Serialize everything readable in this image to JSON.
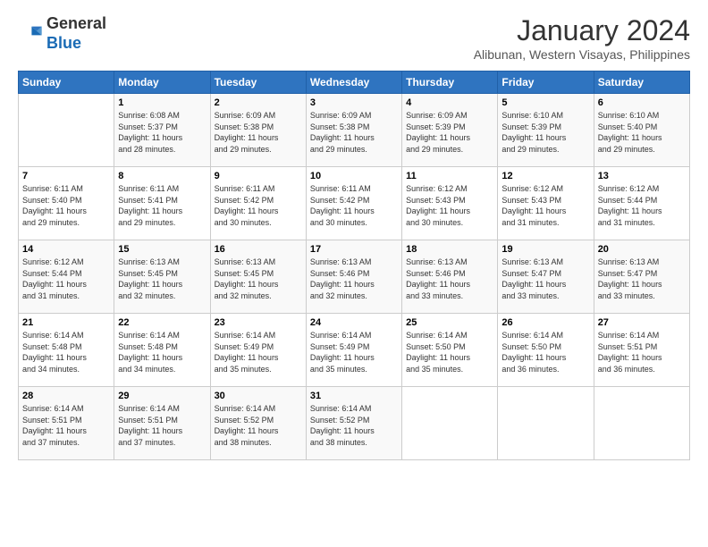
{
  "logo": {
    "general": "General",
    "blue": "Blue"
  },
  "title": "January 2024",
  "subtitle": "Alibunan, Western Visayas, Philippines",
  "days_of_week": [
    "Sunday",
    "Monday",
    "Tuesday",
    "Wednesday",
    "Thursday",
    "Friday",
    "Saturday"
  ],
  "weeks": [
    [
      {
        "day": "",
        "sunrise": "",
        "sunset": "",
        "daylight": ""
      },
      {
        "day": "1",
        "sunrise": "6:08 AM",
        "sunset": "5:37 PM",
        "daylight": "11 hours and 28 minutes."
      },
      {
        "day": "2",
        "sunrise": "6:09 AM",
        "sunset": "5:38 PM",
        "daylight": "11 hours and 29 minutes."
      },
      {
        "day": "3",
        "sunrise": "6:09 AM",
        "sunset": "5:38 PM",
        "daylight": "11 hours and 29 minutes."
      },
      {
        "day": "4",
        "sunrise": "6:09 AM",
        "sunset": "5:39 PM",
        "daylight": "11 hours and 29 minutes."
      },
      {
        "day": "5",
        "sunrise": "6:10 AM",
        "sunset": "5:39 PM",
        "daylight": "11 hours and 29 minutes."
      },
      {
        "day": "6",
        "sunrise": "6:10 AM",
        "sunset": "5:40 PM",
        "daylight": "11 hours and 29 minutes."
      }
    ],
    [
      {
        "day": "7",
        "sunrise": "6:11 AM",
        "sunset": "5:40 PM",
        "daylight": "11 hours and 29 minutes."
      },
      {
        "day": "8",
        "sunrise": "6:11 AM",
        "sunset": "5:41 PM",
        "daylight": "11 hours and 29 minutes."
      },
      {
        "day": "9",
        "sunrise": "6:11 AM",
        "sunset": "5:42 PM",
        "daylight": "11 hours and 30 minutes."
      },
      {
        "day": "10",
        "sunrise": "6:11 AM",
        "sunset": "5:42 PM",
        "daylight": "11 hours and 30 minutes."
      },
      {
        "day": "11",
        "sunrise": "6:12 AM",
        "sunset": "5:43 PM",
        "daylight": "11 hours and 30 minutes."
      },
      {
        "day": "12",
        "sunrise": "6:12 AM",
        "sunset": "5:43 PM",
        "daylight": "11 hours and 31 minutes."
      },
      {
        "day": "13",
        "sunrise": "6:12 AM",
        "sunset": "5:44 PM",
        "daylight": "11 hours and 31 minutes."
      }
    ],
    [
      {
        "day": "14",
        "sunrise": "6:12 AM",
        "sunset": "5:44 PM",
        "daylight": "11 hours and 31 minutes."
      },
      {
        "day": "15",
        "sunrise": "6:13 AM",
        "sunset": "5:45 PM",
        "daylight": "11 hours and 32 minutes."
      },
      {
        "day": "16",
        "sunrise": "6:13 AM",
        "sunset": "5:45 PM",
        "daylight": "11 hours and 32 minutes."
      },
      {
        "day": "17",
        "sunrise": "6:13 AM",
        "sunset": "5:46 PM",
        "daylight": "11 hours and 32 minutes."
      },
      {
        "day": "18",
        "sunrise": "6:13 AM",
        "sunset": "5:46 PM",
        "daylight": "11 hours and 33 minutes."
      },
      {
        "day": "19",
        "sunrise": "6:13 AM",
        "sunset": "5:47 PM",
        "daylight": "11 hours and 33 minutes."
      },
      {
        "day": "20",
        "sunrise": "6:13 AM",
        "sunset": "5:47 PM",
        "daylight": "11 hours and 33 minutes."
      }
    ],
    [
      {
        "day": "21",
        "sunrise": "6:14 AM",
        "sunset": "5:48 PM",
        "daylight": "11 hours and 34 minutes."
      },
      {
        "day": "22",
        "sunrise": "6:14 AM",
        "sunset": "5:48 PM",
        "daylight": "11 hours and 34 minutes."
      },
      {
        "day": "23",
        "sunrise": "6:14 AM",
        "sunset": "5:49 PM",
        "daylight": "11 hours and 35 minutes."
      },
      {
        "day": "24",
        "sunrise": "6:14 AM",
        "sunset": "5:49 PM",
        "daylight": "11 hours and 35 minutes."
      },
      {
        "day": "25",
        "sunrise": "6:14 AM",
        "sunset": "5:50 PM",
        "daylight": "11 hours and 35 minutes."
      },
      {
        "day": "26",
        "sunrise": "6:14 AM",
        "sunset": "5:50 PM",
        "daylight": "11 hours and 36 minutes."
      },
      {
        "day": "27",
        "sunrise": "6:14 AM",
        "sunset": "5:51 PM",
        "daylight": "11 hours and 36 minutes."
      }
    ],
    [
      {
        "day": "28",
        "sunrise": "6:14 AM",
        "sunset": "5:51 PM",
        "daylight": "11 hours and 37 minutes."
      },
      {
        "day": "29",
        "sunrise": "6:14 AM",
        "sunset": "5:51 PM",
        "daylight": "11 hours and 37 minutes."
      },
      {
        "day": "30",
        "sunrise": "6:14 AM",
        "sunset": "5:52 PM",
        "daylight": "11 hours and 38 minutes."
      },
      {
        "day": "31",
        "sunrise": "6:14 AM",
        "sunset": "5:52 PM",
        "daylight": "11 hours and 38 minutes."
      },
      {
        "day": "",
        "sunrise": "",
        "sunset": "",
        "daylight": ""
      },
      {
        "day": "",
        "sunrise": "",
        "sunset": "",
        "daylight": ""
      },
      {
        "day": "",
        "sunrise": "",
        "sunset": "",
        "daylight": ""
      }
    ]
  ],
  "labels": {
    "sunrise": "Sunrise:",
    "sunset": "Sunset:",
    "daylight": "Daylight:"
  }
}
